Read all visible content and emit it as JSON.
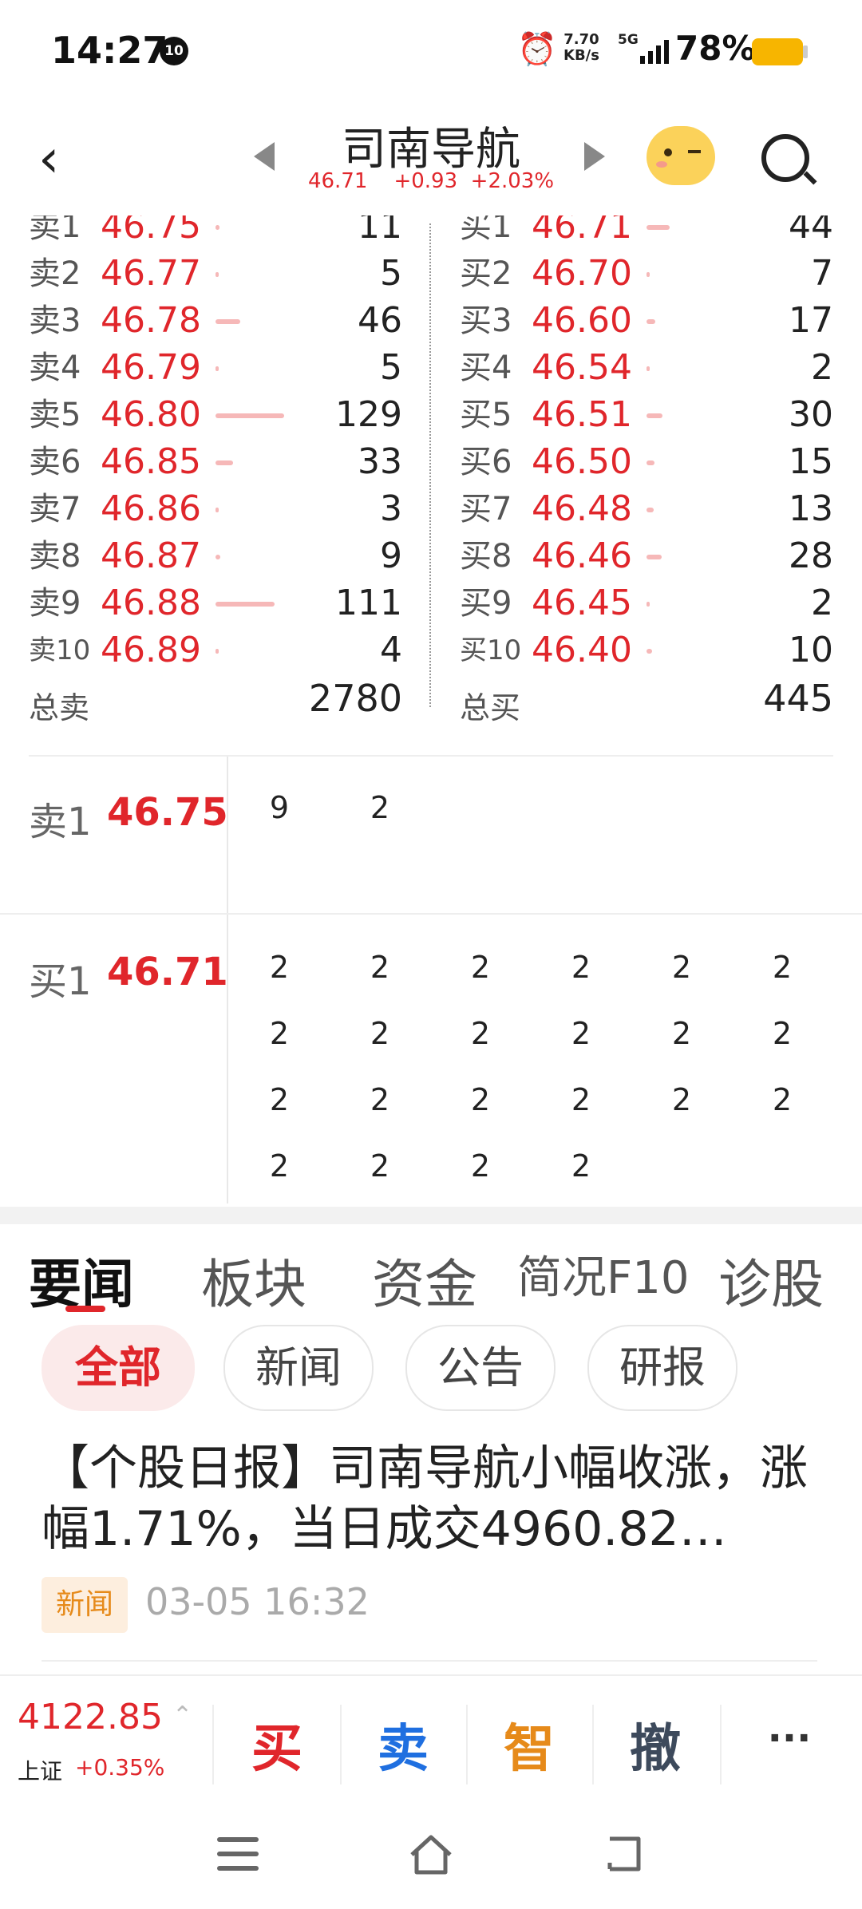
{
  "status": {
    "time": "14:27",
    "badge": "10",
    "speed_value": "7.70",
    "speed_unit": "KB/s",
    "network": "5G",
    "battery": "78%"
  },
  "header": {
    "title": "司南导航",
    "price": "46.71",
    "change": "+0.93",
    "change_pct": "+2.03%"
  },
  "orderbook": {
    "asks": [
      {
        "label": "卖1",
        "price": "46.75",
        "vol": "11",
        "bar": 0.06
      },
      {
        "label": "卖2",
        "price": "46.77",
        "vol": "5",
        "bar": 0.03
      },
      {
        "label": "卖3",
        "price": "46.78",
        "vol": "46",
        "bar": 0.36
      },
      {
        "label": "卖4",
        "price": "46.79",
        "vol": "5",
        "bar": 0.03
      },
      {
        "label": "卖5",
        "price": "46.80",
        "vol": "129",
        "bar": 1.0
      },
      {
        "label": "卖6",
        "price": "46.85",
        "vol": "33",
        "bar": 0.26
      },
      {
        "label": "卖7",
        "price": "46.86",
        "vol": "3",
        "bar": 0.02
      },
      {
        "label": "卖8",
        "price": "46.87",
        "vol": "9",
        "bar": 0.07
      },
      {
        "label": "卖9",
        "price": "46.88",
        "vol": "111",
        "bar": 0.86
      },
      {
        "label": "卖10",
        "price": "46.89",
        "vol": "4",
        "bar": 0.03
      }
    ],
    "bids": [
      {
        "label": "买1",
        "price": "46.71",
        "vol": "44",
        "bar": 0.34
      },
      {
        "label": "买2",
        "price": "46.70",
        "vol": "7",
        "bar": 0.05
      },
      {
        "label": "买3",
        "price": "46.60",
        "vol": "17",
        "bar": 0.13
      },
      {
        "label": "买4",
        "price": "46.54",
        "vol": "2",
        "bar": 0.02
      },
      {
        "label": "买5",
        "price": "46.51",
        "vol": "30",
        "bar": 0.23
      },
      {
        "label": "买6",
        "price": "46.50",
        "vol": "15",
        "bar": 0.12
      },
      {
        "label": "买7",
        "price": "46.48",
        "vol": "13",
        "bar": 0.1
      },
      {
        "label": "买8",
        "price": "46.46",
        "vol": "28",
        "bar": 0.22
      },
      {
        "label": "买9",
        "price": "46.45",
        "vol": "2",
        "bar": 0.02
      },
      {
        "label": "买10",
        "price": "46.40",
        "vol": "10",
        "bar": 0.08
      }
    ],
    "total_sell_label": "总卖",
    "total_sell": "2780",
    "total_buy_label": "总买",
    "total_buy": "445"
  },
  "queue": {
    "sell": {
      "label": "卖1",
      "price": "46.75",
      "orders": [
        "9",
        "2"
      ]
    },
    "buy": {
      "label": "买1",
      "price": "46.71",
      "orders": [
        "2",
        "2",
        "2",
        "2",
        "2",
        "2",
        "2",
        "2",
        "2",
        "2",
        "2",
        "2",
        "2",
        "2",
        "2",
        "2",
        "2",
        "2",
        "2",
        "2",
        "2",
        "2"
      ]
    }
  },
  "tabs": [
    "要闻",
    "板块",
    "资金",
    "简况F10",
    "诊股"
  ],
  "chips": [
    "全部",
    "新闻",
    "公告",
    "研报"
  ],
  "news": {
    "title": "【个股日报】司南导航小幅收涨，涨幅1.71%，当日成交4960.82…",
    "tag": "新闻",
    "time": "03-05 16:32"
  },
  "bottom": {
    "index_value": "4122.85",
    "index_name": "上证",
    "index_change": "+0.35%",
    "buy": "买",
    "sell": "卖",
    "smart": "智",
    "cancel": "撤",
    "more": "···"
  },
  "colors": {
    "up": "#e0262b",
    "bar": "#f6b8b8",
    "sell_btn": "#1f6fe0",
    "smart_btn": "#e68a1a"
  }
}
